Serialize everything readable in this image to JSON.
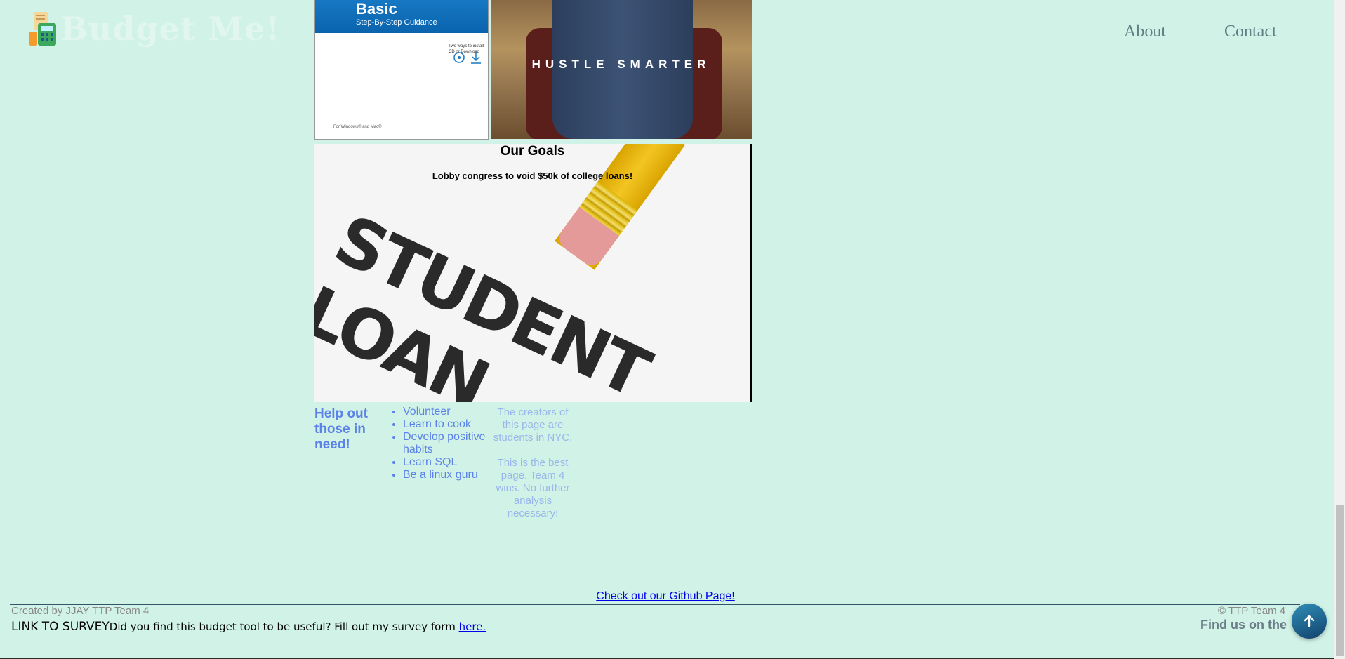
{
  "header": {
    "site_name": "Budget Me!",
    "nav": {
      "about": "About",
      "contact": "Contact"
    }
  },
  "products": {
    "box_title": "Basic",
    "box_subtitle": "Step-By-Step Guidance",
    "box_note": "Two ways to install: CD or Download",
    "box_footer": "For Windows® and Mac®",
    "book_title": "HUSTLE SMARTER"
  },
  "goals": {
    "title": "Our Goals",
    "text": "Lobby congress to void $50k of college loans!",
    "image_text": "STUDENT LOAN"
  },
  "help": {
    "title": "Help out those in need!",
    "items": [
      "Volunteer",
      "Learn to cook",
      "Develop positive habits",
      "Learn SQL",
      "Be a linux guru"
    ],
    "aside_1": "The creators of this page are students in NYC.",
    "aside_2": "This is the best page. Team 4 wins. No further analysis necessary!"
  },
  "footer": {
    "github_link": "Check out our Github Page!",
    "created_by": "Created by JJAY TTP Team 4",
    "copyright": "© TTP Team 4",
    "survey_label": "LINK TO SURVEY",
    "survey_text": "Did you find this budget tool to be useful? Fill out my survey form ",
    "survey_link": "here.",
    "find_us": "Find us on the"
  },
  "icons": {
    "logo": "calculator-receipt-icon",
    "back_to_top": "arrow-up-icon"
  },
  "colors": {
    "background": "#d1f2e6",
    "accent_blue": "#5b82e8",
    "link": "#0000ee"
  }
}
